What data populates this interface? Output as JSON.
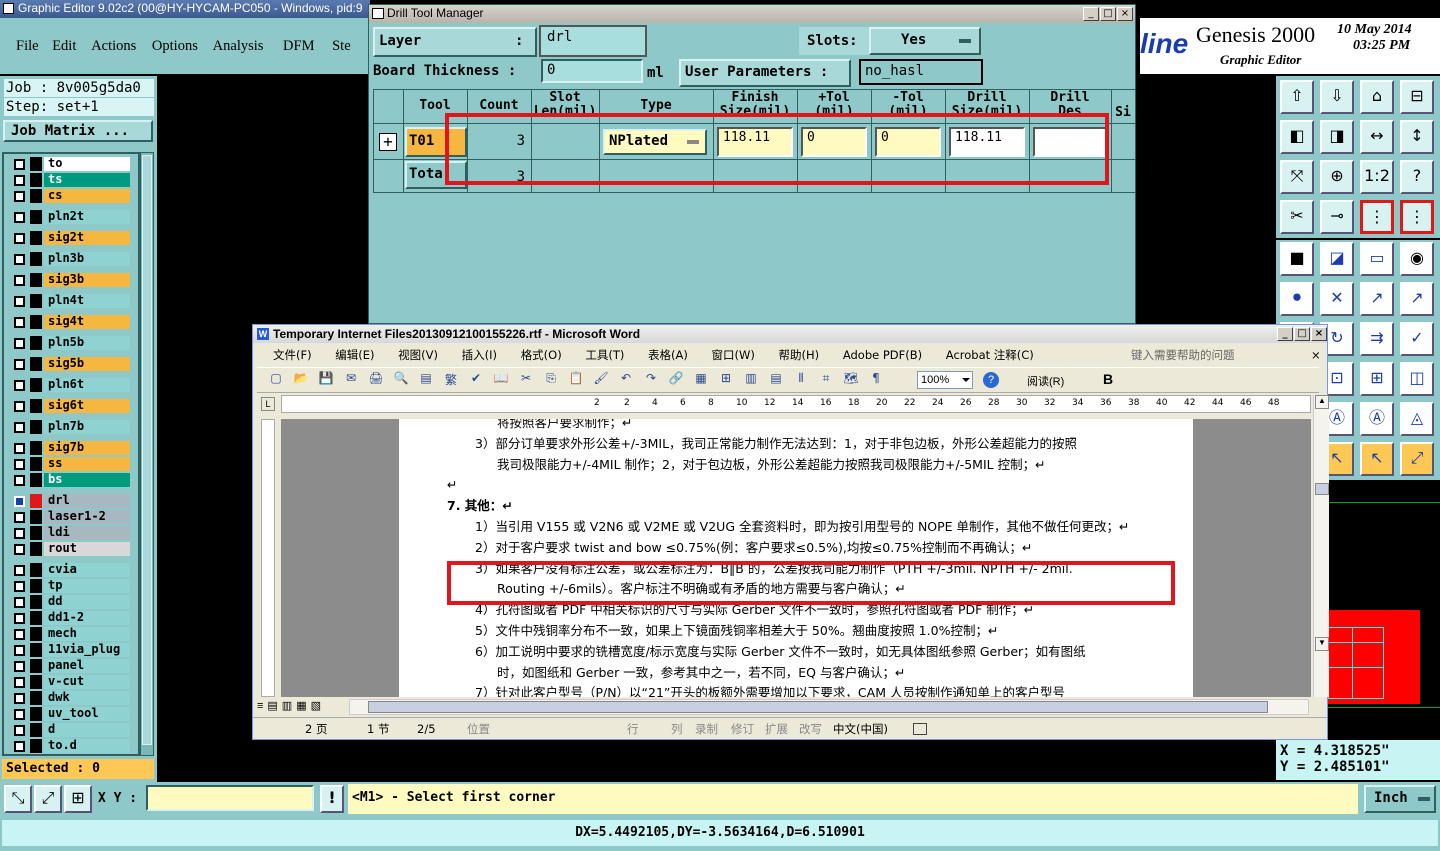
{
  "genesis": {
    "title": "Graphic Editor 9.02c2 (00@HY-HYCAM-PC050 - Windows, pid:9",
    "menu": [
      "File",
      "Edit",
      "Actions",
      "Options",
      "Analysis",
      "DFM",
      "Ste"
    ],
    "job": "Job : 8v005g5da0",
    "step": "Step: set+1",
    "job_matrix": "Job Matrix ...",
    "brand_partial": "line",
    "brand": "Genesis 2000",
    "subtitle": "Graphic Editor",
    "date": "10 May 2014",
    "time": "03:25 PM",
    "layers": [
      {
        "name": "to",
        "color": "#ffffff"
      },
      {
        "name": "ts",
        "color": "#009a7e"
      },
      {
        "name": "cs",
        "color": "#f5b73f"
      },
      {
        "name": "pln2t",
        "color": "#8fd2d2"
      },
      {
        "name": "sig2t",
        "color": "#f5b73f"
      },
      {
        "name": "pln3b",
        "color": "#8fd2d2"
      },
      {
        "name": "sig3b",
        "color": "#f5b73f"
      },
      {
        "name": "pln4t",
        "color": "#8fd2d2"
      },
      {
        "name": "sig4t",
        "color": "#f5b73f"
      },
      {
        "name": "pln5b",
        "color": "#8fd2d2"
      },
      {
        "name": "sig5b",
        "color": "#f5b73f"
      },
      {
        "name": "pln6t",
        "color": "#8fd2d2"
      },
      {
        "name": "sig6t",
        "color": "#f5b73f"
      },
      {
        "name": "pln7b",
        "color": "#8fd2d2"
      },
      {
        "name": "sig7b",
        "color": "#f5b73f"
      },
      {
        "name": "ss",
        "color": "#f5b73f"
      },
      {
        "name": "bs",
        "color": "#009a7e"
      },
      {
        "name": "drl",
        "color": "#a8b8c0"
      },
      {
        "name": "laser1-2",
        "color": "#a8b8c0"
      },
      {
        "name": "ldi",
        "color": "#a8b8c0"
      },
      {
        "name": "rout",
        "color": "#d8d8d8"
      },
      {
        "name": "cvia",
        "color": "#8fd2d2"
      },
      {
        "name": "tp",
        "color": "#8fd2d2"
      },
      {
        "name": "dd",
        "color": "#8fd2d2"
      },
      {
        "name": "dd1-2",
        "color": "#8fd2d2"
      },
      {
        "name": "mech",
        "color": "#8fd2d2"
      },
      {
        "name": "11via_plug",
        "color": "#8fd2d2"
      },
      {
        "name": "panel",
        "color": "#8fd2d2"
      },
      {
        "name": "v-cut",
        "color": "#8fd2d2"
      },
      {
        "name": "dwk",
        "color": "#8fd2d2"
      },
      {
        "name": "uv_tool",
        "color": "#8fd2d2"
      },
      {
        "name": "d",
        "color": "#8fd2d2"
      },
      {
        "name": "to.d",
        "color": "#8fd2d2"
      }
    ],
    "selected": "Selected : 0",
    "coord_x": "X = 4.318525\"",
    "coord_y": "Y = 2.485101\"",
    "xy_label": "X Y :",
    "prompt": "<M1> - Select first corner",
    "unit": "Inch",
    "status": "DX=5.4492105,DY=-3.5634164,D=6.510901",
    "icon_labels": [
      "1:2",
      "?"
    ]
  },
  "drill": {
    "title": "Drill Tool Manager",
    "layer_label": "Layer",
    "layer_colon": ":",
    "layer_value": "drl",
    "slots_label": "Slots:",
    "slots_value": "Yes",
    "board_label": "Board Thickness :",
    "board_value": "0",
    "board_unit": "ml",
    "user_params_label": "User Parameters :",
    "user_params_value": "no_hasl",
    "headers": {
      "tool": "Tool",
      "count": "Count",
      "slot1": "Slot",
      "slot2": "Len(mil)",
      "type": "Type",
      "finish1": "Finish",
      "finish2": "Size(mil)",
      "ptol1": "+Tol",
      "ptol2": "(mil)",
      "ntol1": "-Tol",
      "ntol2": "(mil)",
      "drill1": "Drill",
      "drill2": "Size(mil)",
      "des1": "Drill",
      "des2": "Des",
      "si": "Si"
    },
    "row": {
      "tool": "T01",
      "count": "3",
      "type": "NPlated",
      "finish": "118.11",
      "ptol": "0",
      "ntol": "0",
      "drill": "118.11",
      "des": ""
    },
    "total": {
      "label": "Tota",
      "count": "3"
    }
  },
  "word": {
    "title": "Temporary Internet Files20130912100155226.rtf - Microsoft Word",
    "menu": [
      "文件(F)",
      "编辑(E)",
      "视图(V)",
      "插入(I)",
      "格式(O)",
      "工具(T)",
      "表格(A)",
      "窗口(W)",
      "帮助(H)",
      "Adobe PDF(B)",
      "Acrobat 注释(C)"
    ],
    "help_placeholder": "键入需要帮助的问题",
    "zoom": "100%",
    "read_label": "阅读(R)",
    "ruler": [
      "2",
      "2",
      "4",
      "6",
      "8",
      "10",
      "12",
      "14",
      "16",
      "18",
      "20",
      "22",
      "24",
      "26",
      "28",
      "30",
      "32",
      "34",
      "36",
      "38",
      "40",
      "42",
      "44",
      "46",
      "48"
    ],
    "lines": [
      {
        "indent": 0,
        "text": "将按照客户要求制作；↵"
      },
      {
        "indent": 1,
        "text": "3）部分订单要求外形公差+/-3MIL，我司正常能力制作无法达到：1，对于非包边板，外形公差超能力的按照"
      },
      {
        "indent": 0,
        "text": "我司极限能力+/-4MIL 制作；2，对于包边板，外形公差超能力按照我司极限能力+/-5MIL 控制；↵"
      },
      {
        "indent": 2,
        "text": "↵"
      },
      {
        "indent": 3,
        "text": "7.  其他：↵"
      },
      {
        "indent": 1,
        "text": "1）当引用 V155 或 V2N6 或 V2ME 或 V2UG 全套资料时，即为按引用型号的 NOPE 单制作，其他不做任何更改；↵"
      },
      {
        "indent": 1,
        "text": "2）对于客户要求 twist and bow ≤0.75%(例：客户要求≤0.5%),均按≤0.75%控制而不再确认；↵"
      },
      {
        "indent": 1,
        "text": "3）如果客户没有标注公差，或公差标注为：B‖B 的，公差按我司能力制作（PTH +/-3mil. NPTH +/- 2mil."
      },
      {
        "indent": 0,
        "text": "Routing +/-6mils）。客户标注不明确或有矛盾的地方需要与客户确认；↵"
      },
      {
        "indent": 1,
        "text": "4）孔符图或者 PDF 中相关标识的尺寸与实际 Gerber 文件不一致时，参照孔符图或者 PDF 制作；↵"
      },
      {
        "indent": 1,
        "text": "5）文件中残铜率分布不一致，如果上下镜面残铜率相差大于 50%。翘曲度按照 1.0%控制；↵"
      },
      {
        "indent": 1,
        "text": "6）加工说明中要求的铣槽宽度/标示宽度与实际 Gerber 文件不一致时，如无具体图纸参照 Gerber；如有图纸"
      },
      {
        "indent": 0,
        "text": "时，如图纸和 Gerber 一致，参考其中之一，若不同，EQ 与客户确认；↵"
      },
      {
        "indent": 1,
        "text": "7）针对此客户型号（P/N）以“21”开头的板额外需要增加以下要求，CAM 人员按制作通知单上的客户型号"
      }
    ],
    "status": [
      "2 页",
      "1 节",
      "2/5",
      "位置",
      "行",
      "列",
      "录制",
      "修订",
      "扩展",
      "改写",
      "中文(中国)"
    ]
  },
  "colors": {
    "teal": "#8fc8c8",
    "highlight": "#e0161e",
    "cyan": "#c8f4f4"
  }
}
